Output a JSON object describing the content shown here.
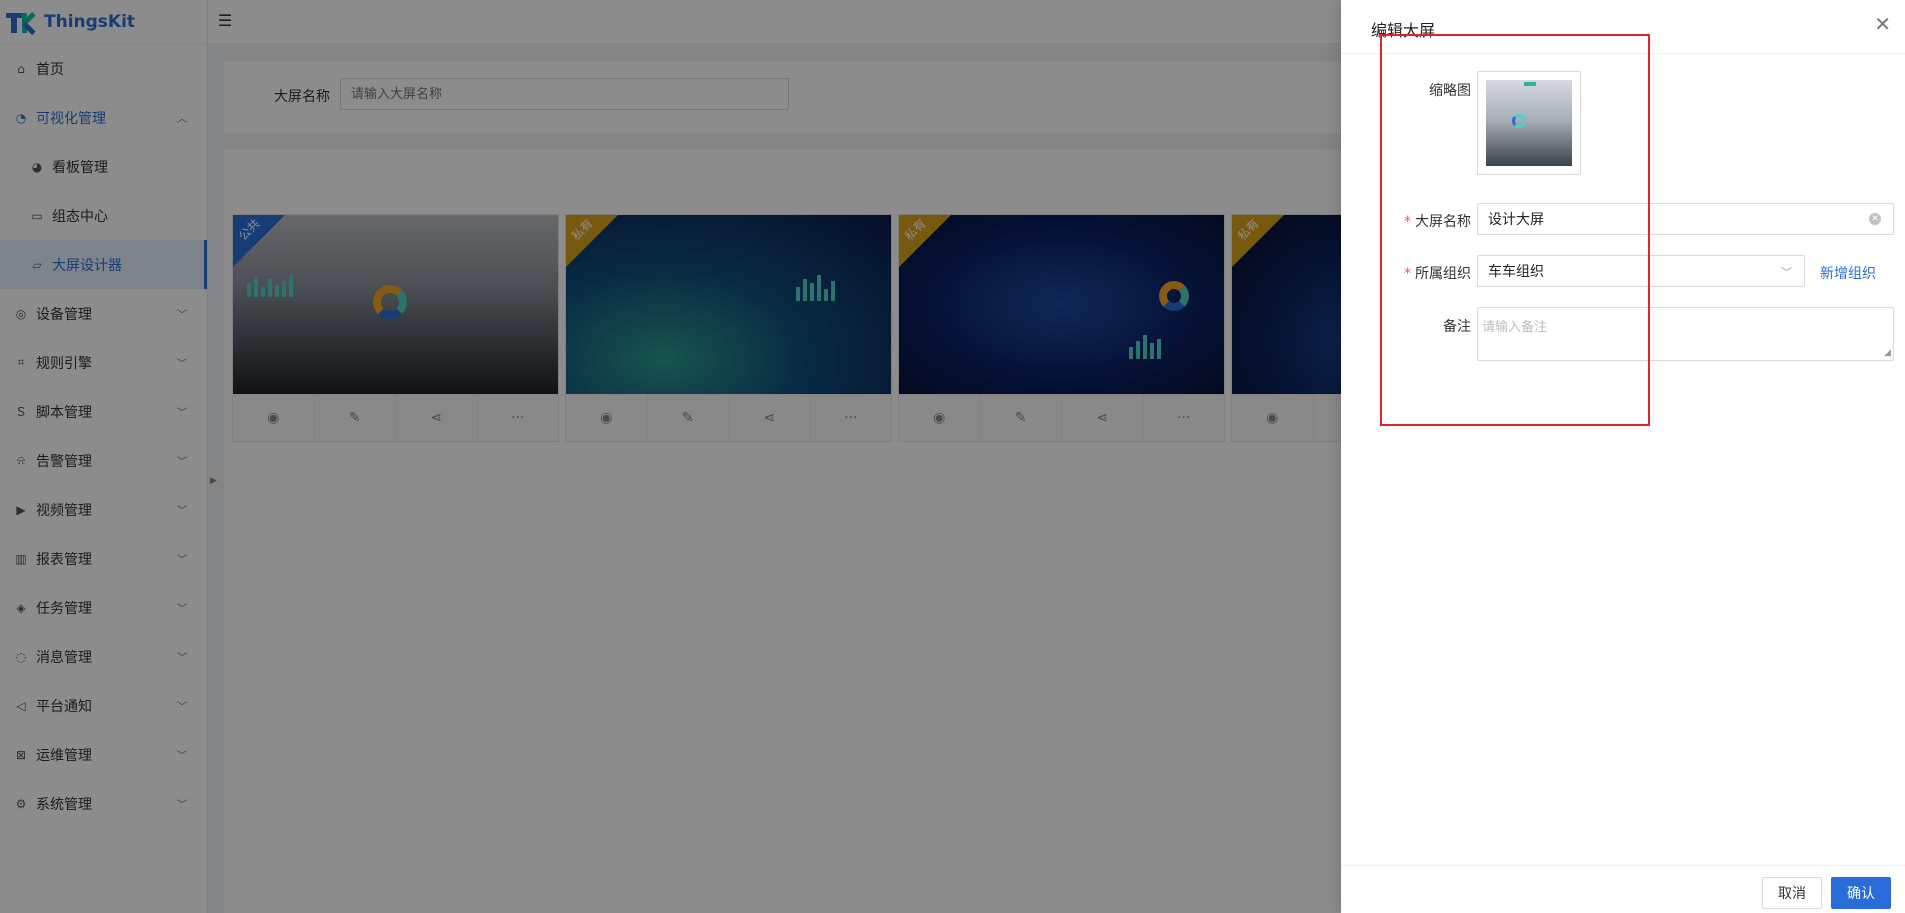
{
  "app": {
    "title": "ThingsKit"
  },
  "sidebar": {
    "items": [
      {
        "label": "首页",
        "icon": "home-icon"
      },
      {
        "label": "可视化管理",
        "icon": "dashboard-icon"
      },
      {
        "label": "看板管理",
        "icon": "pie-icon"
      },
      {
        "label": "组态中心",
        "icon": "monitor-icon"
      },
      {
        "label": "大屏设计器",
        "icon": "screen-icon"
      },
      {
        "label": "设备管理",
        "icon": "device-icon"
      },
      {
        "label": "规则引擎",
        "icon": "rule-icon"
      },
      {
        "label": "脚本管理",
        "icon": "script-icon"
      },
      {
        "label": "告警管理",
        "icon": "alarm-icon"
      },
      {
        "label": "视频管理",
        "icon": "video-icon"
      },
      {
        "label": "报表管理",
        "icon": "chart-icon"
      },
      {
        "label": "任务管理",
        "icon": "task-icon"
      },
      {
        "label": "消息管理",
        "icon": "message-icon"
      },
      {
        "label": "平台通知",
        "icon": "notice-icon"
      },
      {
        "label": "运维管理",
        "icon": "ops-icon"
      },
      {
        "label": "系统管理",
        "icon": "gear-icon"
      }
    ]
  },
  "search": {
    "label": "大屏名称",
    "placeholder": "请输入大屏名称"
  },
  "cards": [
    {
      "ribbon": "公共"
    },
    {
      "ribbon": "私有"
    },
    {
      "ribbon": "私有"
    },
    {
      "ribbon": "私有"
    }
  ],
  "drawer": {
    "title": "编辑大屏",
    "thumbnail_label": "缩略图",
    "name_label": "大屏名称",
    "name_value": "设计大屏",
    "org_label": "所属组织",
    "org_value": "车车组织",
    "add_org_link": "新增组织",
    "remark_label": "备注",
    "remark_placeholder": "请输入备注",
    "cancel_label": "取消",
    "ok_label": "确认"
  },
  "colors": {
    "primary": "#2a6dd8",
    "highlight": "#e0252a",
    "required": "#ff4d4f"
  }
}
